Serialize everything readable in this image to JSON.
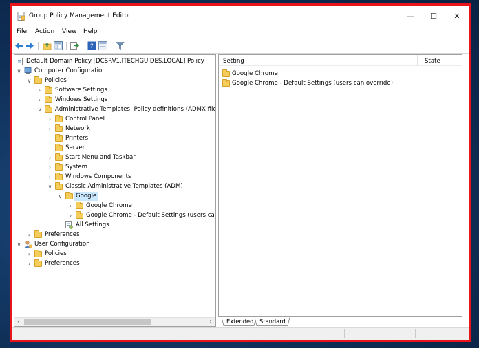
{
  "window": {
    "title": "Group Policy Management Editor",
    "minimize_symbol": "—",
    "maximize_symbol": "☐",
    "close_symbol": "✕"
  },
  "menu": [
    "File",
    "Action",
    "View",
    "Help"
  ],
  "toolbar": {
    "icons": [
      "back-arrow-icon",
      "forward-arrow-icon",
      "up-folder-icon",
      "show-hide-tree-icon",
      "export-list-icon",
      "help-icon",
      "properties-icon",
      "filter-icon"
    ]
  },
  "tree": {
    "root": "Default Domain Policy [DCSRV1.ITECHGUIDES.LOCAL] Policy",
    "computer_configuration": "Computer Configuration",
    "policies": "Policies",
    "software_settings": "Software Settings",
    "windows_settings": "Windows Settings",
    "admin_templates": "Administrative Templates: Policy definitions (ADMX files)",
    "control_panel": "Control Panel",
    "network": "Network",
    "printers": "Printers",
    "server": "Server",
    "start_menu": "Start Menu and Taskbar",
    "system": "System",
    "windows_components": "Windows Components",
    "classic_admin": "Classic Administrative Templates (ADM)",
    "google": "Google",
    "google_chrome": "Google Chrome",
    "google_chrome_default": "Google Chrome - Default Settings (users can o",
    "all_settings": "All Settings",
    "preferences": "Preferences",
    "user_configuration": "User Configuration",
    "user_policies": "Policies",
    "user_preferences": "Preferences"
  },
  "list": {
    "columns": [
      "Setting",
      "State"
    ],
    "items": [
      "Google Chrome",
      "Google Chrome - Default Settings (users can override)"
    ]
  },
  "tabs": [
    "Extended",
    "Standard"
  ]
}
